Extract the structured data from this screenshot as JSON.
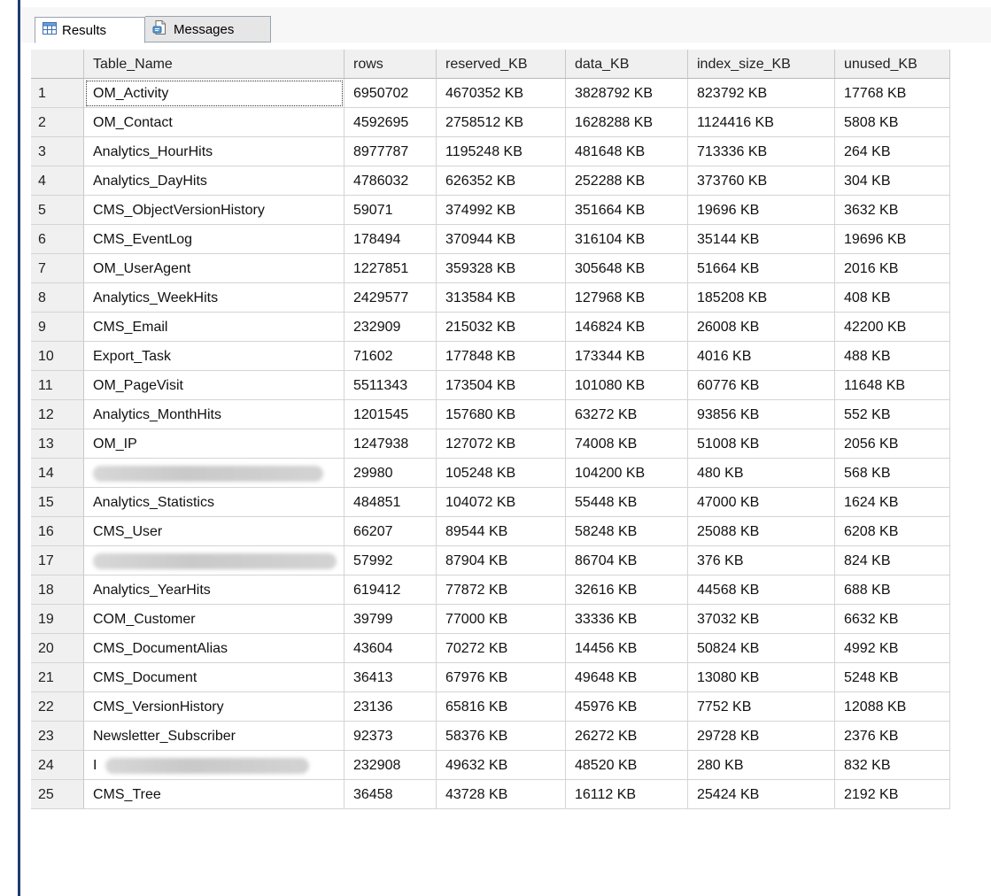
{
  "tabs": [
    {
      "label": "Results",
      "icon": "grid-icon",
      "active": true
    },
    {
      "label": "Messages",
      "icon": "messages-icon",
      "active": false
    }
  ],
  "grid": {
    "columns": [
      "Table_Name",
      "rows",
      "reserved_KB",
      "data_KB",
      "index_size_KB",
      "unused_KB"
    ],
    "rows": [
      {
        "num": "1",
        "name": "OM_Activity",
        "rows": "6950702",
        "reserved": "4670352 KB",
        "data": "3828792 KB",
        "index": "823792 KB",
        "unused": "17768 KB"
      },
      {
        "num": "2",
        "name": "OM_Contact",
        "rows": "4592695",
        "reserved": "2758512 KB",
        "data": "1628288 KB",
        "index": "1124416 KB",
        "unused": "5808 KB"
      },
      {
        "num": "3",
        "name": "Analytics_HourHits",
        "rows": "8977787",
        "reserved": "1195248 KB",
        "data": "481648 KB",
        "index": "713336 KB",
        "unused": "264 KB"
      },
      {
        "num": "4",
        "name": "Analytics_DayHits",
        "rows": "4786032",
        "reserved": "626352 KB",
        "data": "252288 KB",
        "index": "373760 KB",
        "unused": "304 KB"
      },
      {
        "num": "5",
        "name": "CMS_ObjectVersionHistory",
        "rows": "59071",
        "reserved": "374992 KB",
        "data": "351664 KB",
        "index": "19696 KB",
        "unused": "3632 KB"
      },
      {
        "num": "6",
        "name": "CMS_EventLog",
        "rows": "178494",
        "reserved": "370944 KB",
        "data": "316104 KB",
        "index": "35144 KB",
        "unused": "19696 KB"
      },
      {
        "num": "7",
        "name": "OM_UserAgent",
        "rows": "1227851",
        "reserved": "359328 KB",
        "data": "305648 KB",
        "index": "51664 KB",
        "unused": "2016 KB"
      },
      {
        "num": "8",
        "name": "Analytics_WeekHits",
        "rows": "2429577",
        "reserved": "313584 KB",
        "data": "127968 KB",
        "index": "185208 KB",
        "unused": "408 KB"
      },
      {
        "num": "9",
        "name": "CMS_Email",
        "rows": "232909",
        "reserved": "215032 KB",
        "data": "146824 KB",
        "index": "26008 KB",
        "unused": "42200 KB"
      },
      {
        "num": "10",
        "name": "Export_Task",
        "rows": "71602",
        "reserved": "177848 KB",
        "data": "173344 KB",
        "index": "4016 KB",
        "unused": "488 KB"
      },
      {
        "num": "11",
        "name": "OM_PageVisit",
        "rows": "5511343",
        "reserved": "173504 KB",
        "data": "101080 KB",
        "index": "60776 KB",
        "unused": "11648 KB"
      },
      {
        "num": "12",
        "name": "Analytics_MonthHits",
        "rows": "1201545",
        "reserved": "157680 KB",
        "data": "63272 KB",
        "index": "93856 KB",
        "unused": "552 KB"
      },
      {
        "num": "13",
        "name": "OM_IP",
        "rows": "1247938",
        "reserved": "127072 KB",
        "data": "74008 KB",
        "index": "51008 KB",
        "unused": "2056 KB"
      },
      {
        "num": "14",
        "name": "",
        "rows": "29980",
        "reserved": "105248 KB",
        "data": "104200 KB",
        "index": "480 KB",
        "unused": "568 KB"
      },
      {
        "num": "15",
        "name": "Analytics_Statistics",
        "rows": "484851",
        "reserved": "104072 KB",
        "data": "55448 KB",
        "index": "47000 KB",
        "unused": "1624 KB"
      },
      {
        "num": "16",
        "name": "CMS_User",
        "rows": "66207",
        "reserved": "89544 KB",
        "data": "58248 KB",
        "index": "25088 KB",
        "unused": "6208 KB"
      },
      {
        "num": "17",
        "name": "",
        "rows": "57992",
        "reserved": "87904 KB",
        "data": "86704 KB",
        "index": "376 KB",
        "unused": "824 KB"
      },
      {
        "num": "18",
        "name": "Analytics_YearHits",
        "rows": "619412",
        "reserved": "77872 KB",
        "data": "32616 KB",
        "index": "44568 KB",
        "unused": "688 KB"
      },
      {
        "num": "19",
        "name": "COM_Customer",
        "rows": "39799",
        "reserved": "77000 KB",
        "data": "33336 KB",
        "index": "37032 KB",
        "unused": "6632 KB"
      },
      {
        "num": "20",
        "name": "CMS_DocumentAlias",
        "rows": "43604",
        "reserved": "70272 KB",
        "data": "14456 KB",
        "index": "50824 KB",
        "unused": "4992 KB"
      },
      {
        "num": "21",
        "name": "CMS_Document",
        "rows": "36413",
        "reserved": "67976 KB",
        "data": "49648 KB",
        "index": "13080 KB",
        "unused": "5248 KB"
      },
      {
        "num": "22",
        "name": "CMS_VersionHistory",
        "rows": "23136",
        "reserved": "65816 KB",
        "data": "45976 KB",
        "index": "7752 KB",
        "unused": "12088 KB"
      },
      {
        "num": "23",
        "name": "Newsletter_Subscriber",
        "rows": "92373",
        "reserved": "58376 KB",
        "data": "26272 KB",
        "index": "29728 KB",
        "unused": "2376 KB"
      },
      {
        "num": "24",
        "name": "I",
        "rows": "232908",
        "reserved": "49632 KB",
        "data": "48520 KB",
        "index": "280 KB",
        "unused": "832 KB"
      },
      {
        "num": "25",
        "name": "CMS_Tree",
        "rows": "36458",
        "reserved": "43728 KB",
        "data": "16112 KB",
        "index": "25424 KB",
        "unused": "2192 KB"
      }
    ]
  }
}
